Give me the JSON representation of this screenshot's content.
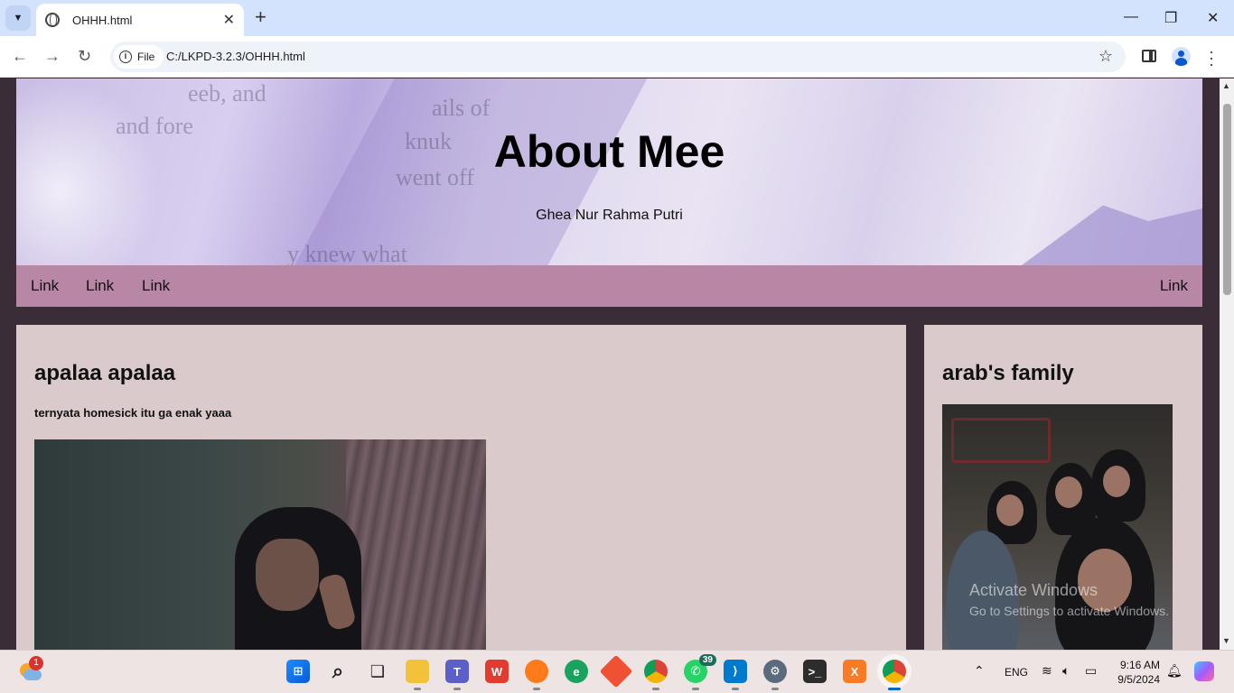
{
  "browser": {
    "tab_title": "OHHH.html",
    "close_glyph": "✕",
    "new_tab_glyph": "+",
    "chip_label": "File",
    "url": "C:/LKPD-3.2.3/OHHH.html",
    "window_minimize": "—",
    "window_restore": "❐",
    "window_close": "✕"
  },
  "page": {
    "header": {
      "title": "About Mee",
      "subtitle": "Ghea Nur Rahma Putri",
      "background_text": [
        "eeb, and",
        "and fore",
        "ails of",
        "knuk",
        "went off",
        "y knew what"
      ]
    },
    "nav": {
      "links": [
        "Link",
        "Link",
        "Link"
      ],
      "right_link": "Link"
    },
    "main": {
      "heading": "apalaa apalaa",
      "subheading": "ternyata homesick itu ga enak yaaa"
    },
    "side": {
      "heading": "arab's family"
    },
    "watermark": {
      "line1": "Activate Windows",
      "line2": "Go to Settings to activate Windows."
    }
  },
  "taskbar": {
    "weather_badge": "1",
    "whatsapp_badge": "39",
    "apps": [
      "windows-start",
      "search",
      "task-view",
      "file-explorer",
      "teams",
      "wps",
      "firefox",
      "edge",
      "git",
      "chrome",
      "whatsapp",
      "vscode",
      "settings",
      "terminal",
      "xampp",
      "chrome-active"
    ],
    "language": "ENG",
    "time": "9:16 AM",
    "date": "9/5/2024"
  },
  "colors": {
    "page_bg": "#3a2d38",
    "nav_bg": "#b887a6",
    "card_bg": "#dbcacb",
    "tabbar_bg": "#d3e3fd",
    "taskbar_bg": "#eee4e4"
  }
}
